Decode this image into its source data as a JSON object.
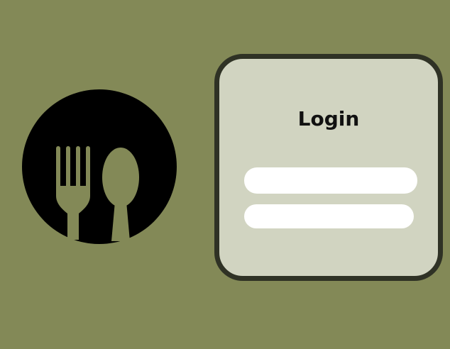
{
  "logo": {
    "icon": "fork-and-spoon-icon",
    "circle_color": "#000000",
    "utensil_color": "#838957"
  },
  "login": {
    "title": "Login",
    "username_field": {
      "value": "",
      "placeholder": ""
    },
    "password_field": {
      "value": "",
      "placeholder": ""
    }
  },
  "colors": {
    "background": "#838957",
    "card_fill": "#d1d4c1",
    "card_border": "#2f3225",
    "field_fill": "#ffffff"
  }
}
